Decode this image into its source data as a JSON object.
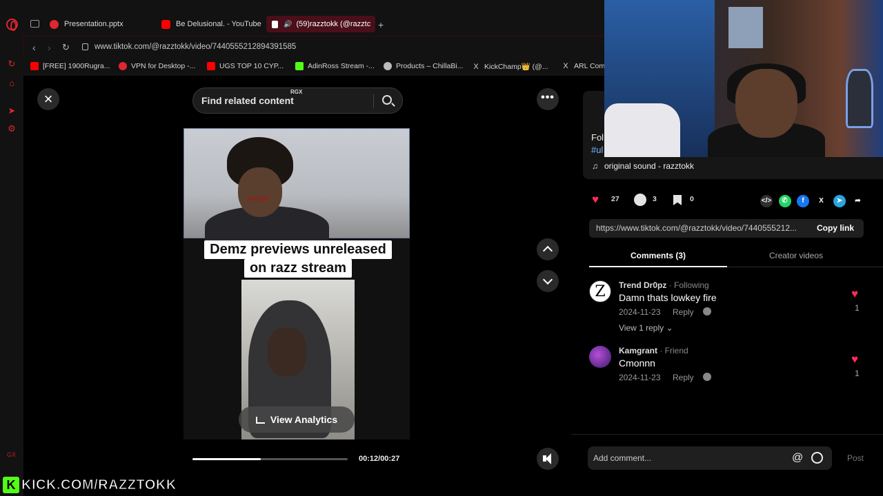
{
  "browser": {
    "tabs": [
      {
        "label": "Presentation.pptx",
        "color": "#e0262e"
      },
      {
        "label": "Be Delusional. - YouTube",
        "color": "#ff0000"
      },
      {
        "label": "(59)razztokk (@razztc",
        "color": "#ffffff"
      }
    ],
    "url": "www.tiktok.com/@razztokk/video/7440555212894391585",
    "bookmarks": [
      {
        "label": "[FREE] 1900Rugra...",
        "color": "#ff0000"
      },
      {
        "label": "VPN for Desktop -...",
        "color": "#e0262e"
      },
      {
        "label": "UGS TOP 10 CYP...",
        "color": "#ff0000"
      },
      {
        "label": "AdinRoss Stream -...",
        "color": "#53fc18"
      },
      {
        "label": "Products – ChillaBi...",
        "color": "#bbbbbb"
      },
      {
        "label": "KickChamp👑 (@...",
        "color": "#ffffff"
      },
      {
        "label": "ARL Com",
        "color": "#ffffff"
      }
    ]
  },
  "player": {
    "search_placeholder": "Find related content",
    "rgx_tag": "RGX",
    "overlay_username": "luv211352",
    "caption_line1": "Demz previews unreleased",
    "caption_line2": "on razz stream",
    "analytics_label": "View Analytics",
    "progress": 0.44,
    "time": "00:12/00:27"
  },
  "panel": {
    "fol_text": "Fol",
    "tag_text": "#ul",
    "sound": "original sound - razztokk",
    "likes": "27",
    "comments": "3",
    "saves": "0",
    "share_icons": [
      {
        "name": "embed-icon",
        "glyph": "</>",
        "color": "#2f2f2f"
      },
      {
        "name": "whatsapp-icon",
        "glyph": "✆",
        "color": "#25d366"
      },
      {
        "name": "facebook-icon",
        "glyph": "f",
        "color": "#1877f2"
      },
      {
        "name": "x-icon",
        "glyph": "X",
        "color": "#000000"
      },
      {
        "name": "telegram-icon",
        "glyph": "➤",
        "color": "#2aa3e0"
      },
      {
        "name": "forward-icon",
        "glyph": "➦",
        "color": "#000000"
      }
    ],
    "link_url": "https://www.tiktok.com/@razztokk/video/7440555212...",
    "copy_link": "Copy link",
    "tab_comments": "Comments (3)",
    "tab_creator": "Creator videos",
    "comments_list": [
      {
        "user": "Trend Dr0pz",
        "relation": " · Following",
        "text": "Damn thats lowkey fire",
        "date": "2024-11-23",
        "reply": "Reply",
        "likes": "1",
        "view_replies": "View 1 reply",
        "avatar_letter": "Z"
      },
      {
        "user": "Kamgrant",
        "relation": " · Friend",
        "text": "Cmonnn",
        "date": "2024-11-23",
        "reply": "Reply",
        "likes": "1"
      }
    ],
    "add_comment": "Add comment...",
    "post": "Post"
  },
  "stream": {
    "kick_handle": "KICK.COM/RAZZTOKK",
    "gx_mark": "GX"
  },
  "colors": {
    "accent": "#fe2c55",
    "kick": "#53fc18",
    "opera": "#e0262e"
  }
}
